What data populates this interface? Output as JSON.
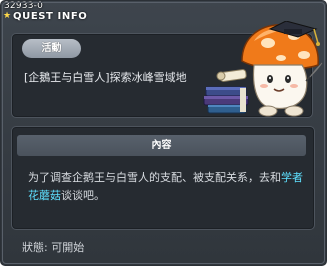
{
  "quest": {
    "id_label": "32933-0",
    "title": "QUEST INFO",
    "state_tag": "活動",
    "name": "[企鵝王与白雪人]探索冰峰雪域地",
    "section_header": "內容",
    "description_part1": "为了调查企鹅王与白雪人的支配、被支配关系，去和",
    "npc_name": "学者花蘑菇",
    "description_part2": "谈谈吧。",
    "status": "狀態: 可開始"
  },
  "colors": {
    "background": "#353b42",
    "panel": "#262b31",
    "npc_highlight": "#5ee0ff",
    "tag": "#a7afb9"
  },
  "icons": {
    "mascot": "mushroom-scholar-icon"
  }
}
